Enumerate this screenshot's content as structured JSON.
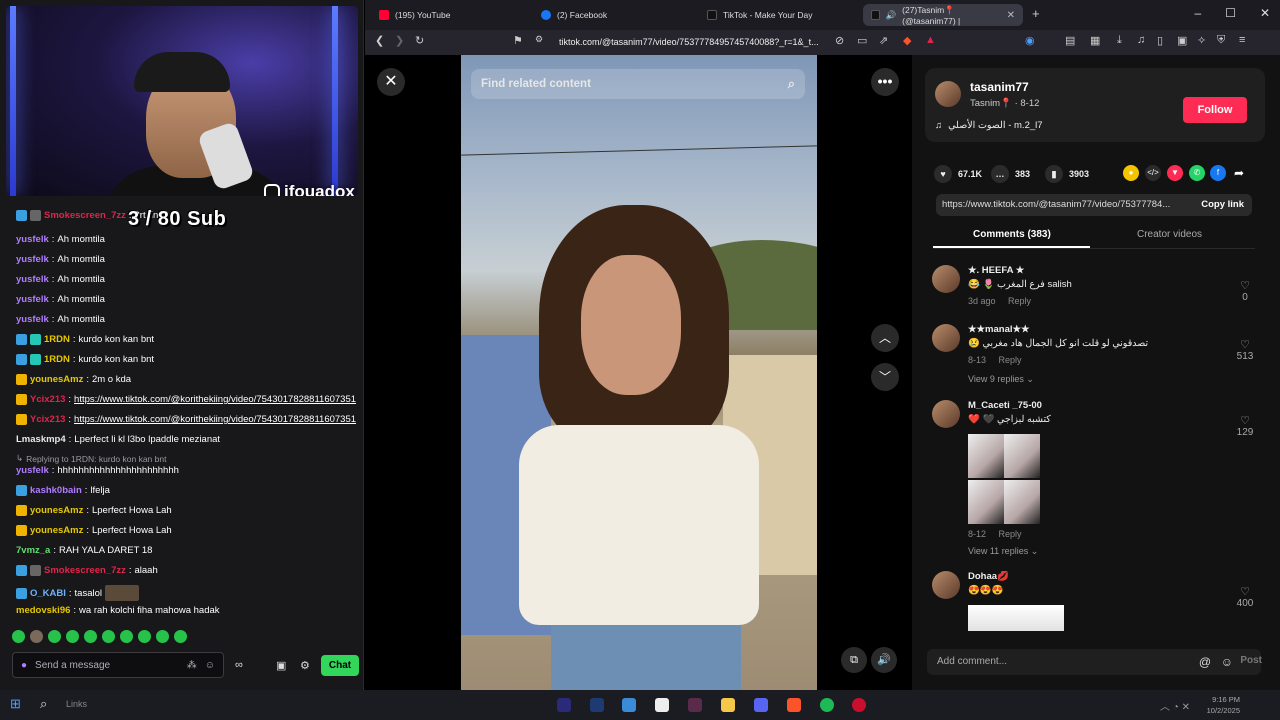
{
  "stream": {
    "handle": "ifouadox",
    "sub_goal": "3 / 80 Sub"
  },
  "chat": {
    "messages": [
      {
        "user": "Smokescreen_7zz",
        "text": "3rt fin r"
      },
      {
        "user": "yusfelk",
        "text": "Ah momtila"
      },
      {
        "user": "yusfelk",
        "text": "Ah momtila"
      },
      {
        "user": "yusfelk",
        "text": "Ah momtila"
      },
      {
        "user": "yusfelk",
        "text": "Ah momtila"
      },
      {
        "user": "yusfelk",
        "text": "Ah momtila"
      },
      {
        "user": "1RDN",
        "text": "kurdo kon kan bnt"
      },
      {
        "user": "1RDN",
        "text": "kurdo kon kan bnt"
      },
      {
        "user": "younesAmz",
        "text": "2m o kda"
      },
      {
        "user": "Ycix213",
        "text": "https://www.tiktok.com/@korithekiing/video/7543017828811607351"
      },
      {
        "user": "Ycix213",
        "text": "https://www.tiktok.com/@korithekiing/video/7543017828811607351"
      },
      {
        "user": "Lmaskmp4",
        "text": "Lperfect li kl l3bo lpaddle mezianat"
      },
      {
        "user": "yusfelk",
        "text": "hhhhhhhhhhhhhhhhhhhhhhh",
        "reply": "Replying to 1RDN: kurdo kon kan bnt"
      },
      {
        "user": "kashk0bain",
        "text": "lfelja"
      },
      {
        "user": "younesAmz",
        "text": "Lperfect Howa Lah"
      },
      {
        "user": "younesAmz",
        "text": "Lperfect Howa Lah"
      },
      {
        "user": "7vmz_a",
        "text": "RAH YALA DARET 18"
      },
      {
        "user": "Smokescreen_7zz",
        "text": "alaah"
      },
      {
        "user": "O_KABI",
        "text": "tasalol"
      },
      {
        "user": "medovski96",
        "text": "wa rah kolchi fiha mahowa hadak"
      }
    ],
    "input_placeholder": "Send a message",
    "chat_button": "Chat"
  },
  "browser": {
    "tabs": [
      {
        "label": "(195) YouTube",
        "color": "#ff0033"
      },
      {
        "label": "(2) Facebook",
        "color": "#1877f2"
      },
      {
        "label": "TikTok - Make Your Day",
        "color": "#111111"
      },
      {
        "label": "(27)Tasnim📍 (@tasanim77) |",
        "color": "#111111"
      }
    ],
    "url": "tiktok.com/@tasanim77/video/7537778495745740088?_r=1&_t..."
  },
  "tiktok": {
    "search_placeholder": "Find related content",
    "author": {
      "username": "tasanim77",
      "display": "Tasnim📍",
      "date": "8-12",
      "sound": "الصوت الأصلي - m.2_l7",
      "follow_label": "Follow"
    },
    "stats": {
      "likes": "67.1K",
      "comments": "383",
      "saves": "3903"
    },
    "link": {
      "url": "https://www.tiktok.com/@tasanim77/video/75377784...",
      "copy_label": "Copy link"
    },
    "tabs": {
      "comments": "Comments (383)",
      "creator": "Creator videos"
    },
    "comments": [
      {
        "name": "★. HEEFA ★",
        "text": "😂 🌷 فرع المغرب salish",
        "date": "3d ago",
        "reply": "Reply",
        "likes": "0"
      },
      {
        "name": "★★manal★★",
        "text": "😢 تصدقوني لو قلت انو كل الجمال هاد مغربي",
        "date": "8-13",
        "reply": "Reply",
        "likes": "513",
        "view_replies": "View 9 replies"
      },
      {
        "name": "M_Caceti _75-00",
        "text": "❤️ 🖤 كتشبه لبزاجي",
        "date": "8-12",
        "reply": "Reply",
        "likes": "129",
        "view_replies": "View 11 replies"
      },
      {
        "name": "Dohaa💋",
        "text": "😍😍😍",
        "likes": "400"
      }
    ],
    "add_comment_placeholder": "Add comment...",
    "post_label": "Post"
  },
  "taskbar": {
    "search_label": "Links",
    "time": "9:16 PM",
    "date": "10/2/2025"
  }
}
